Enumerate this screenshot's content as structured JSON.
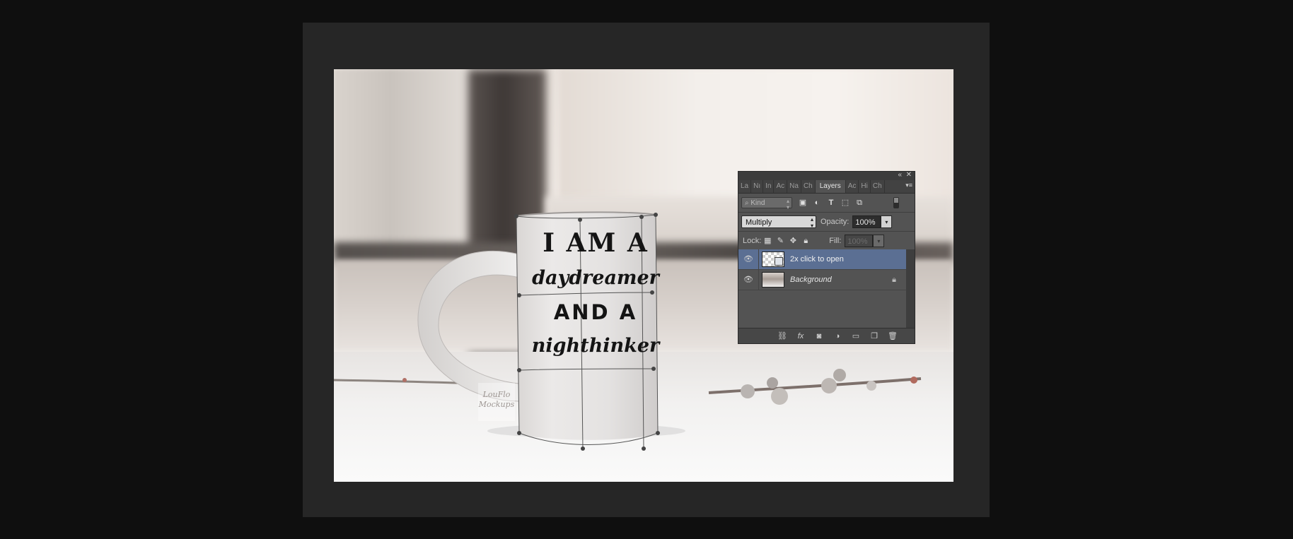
{
  "document": {
    "mug": {
      "line1": "I AM A",
      "line2": "daydreamer",
      "line3": "AND A",
      "line4": "nighthinker"
    },
    "watermark": "LouFlo Mockups"
  },
  "layers_panel": {
    "collapse_glyph": "«",
    "close_glyph": "✕",
    "tabs": [
      "La",
      "Nı",
      "In",
      "Ac",
      "Na",
      "Ch",
      "Layers",
      "Ac",
      "Hi",
      "Ch"
    ],
    "menu_glyph": "▾≡",
    "filter": {
      "kind_label": "Kind",
      "icons": [
        "image-filter-icon",
        "adjustment-filter-icon",
        "type-filter-icon",
        "shape-filter-icon",
        "smart-object-filter-icon"
      ]
    },
    "blend_mode": "Multiply",
    "opacity_label": "Opacity:",
    "opacity_value": "100%",
    "lock_label": "Lock:",
    "fill_label": "Fill:",
    "fill_value": "100%",
    "layers": [
      {
        "name": "2x click to open",
        "selected": true
      },
      {
        "name": "Background",
        "selected": false,
        "locked": true
      }
    ]
  }
}
